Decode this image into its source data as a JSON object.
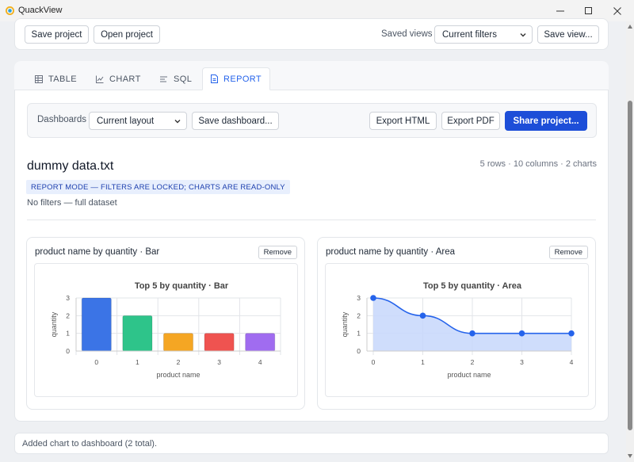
{
  "window": {
    "title": "QuackView"
  },
  "toolbar": {
    "save_project": "Save project",
    "open_project": "Open project",
    "saved_views_label": "Saved views",
    "saved_view_selected": "Current filters",
    "save_view": "Save view..."
  },
  "tabs": [
    {
      "label": "TABLE",
      "icon": "table-icon"
    },
    {
      "label": "CHART",
      "icon": "line-chart-icon"
    },
    {
      "label": "SQL",
      "icon": "sql-icon"
    },
    {
      "label": "REPORT",
      "icon": "document-icon",
      "active": true
    }
  ],
  "report_toolbar": {
    "dashboards_label": "Dashboards",
    "layout_selected": "Current layout",
    "save_dashboard": "Save dashboard...",
    "export_html": "Export HTML",
    "export_pdf": "Export PDF",
    "share_project": "Share project..."
  },
  "report": {
    "title": "dummy data.txt",
    "meta": "5 rows · 10 columns · 2 charts",
    "badge": "REPORT MODE — FILTERS ARE LOCKED; CHARTS ARE READ-ONLY",
    "filters_note": "No filters — full dataset"
  },
  "cards": [
    {
      "title": "product name by quantity · Bar",
      "remove": "Remove"
    },
    {
      "title": "product name by quantity · Area",
      "remove": "Remove"
    }
  ],
  "chart_data": [
    {
      "type": "bar",
      "title": "Top 5 by quantity · Bar",
      "xlabel": "product name",
      "ylabel": "quantity",
      "categories": [
        "0",
        "1",
        "2",
        "3",
        "4"
      ],
      "values": [
        3,
        2,
        1,
        1,
        1
      ],
      "colors": [
        "#3b74e6",
        "#2ec48a",
        "#f5a623",
        "#ef5350",
        "#a06cf0"
      ],
      "yticks": [
        "0",
        "1",
        "2",
        "3"
      ],
      "ylim": [
        0,
        3
      ],
      "grid": true
    },
    {
      "type": "area",
      "title": "Top 5 by quantity · Area",
      "xlabel": "product name",
      "ylabel": "quantity",
      "categories": [
        "0",
        "1",
        "2",
        "3",
        "4"
      ],
      "values": [
        3,
        2,
        1,
        1,
        1
      ],
      "color": "#2563eb",
      "fill": "#c7d7fb",
      "yticks": [
        "0",
        "1",
        "2",
        "3"
      ],
      "ylim": [
        0,
        3
      ],
      "grid": true
    }
  ],
  "status": {
    "message": "Added chart to dashboard (2 total)."
  },
  "colors": {
    "accent": "#1d4ed8",
    "tab_active": "#2563eb",
    "badge_bg": "#e8effd"
  }
}
